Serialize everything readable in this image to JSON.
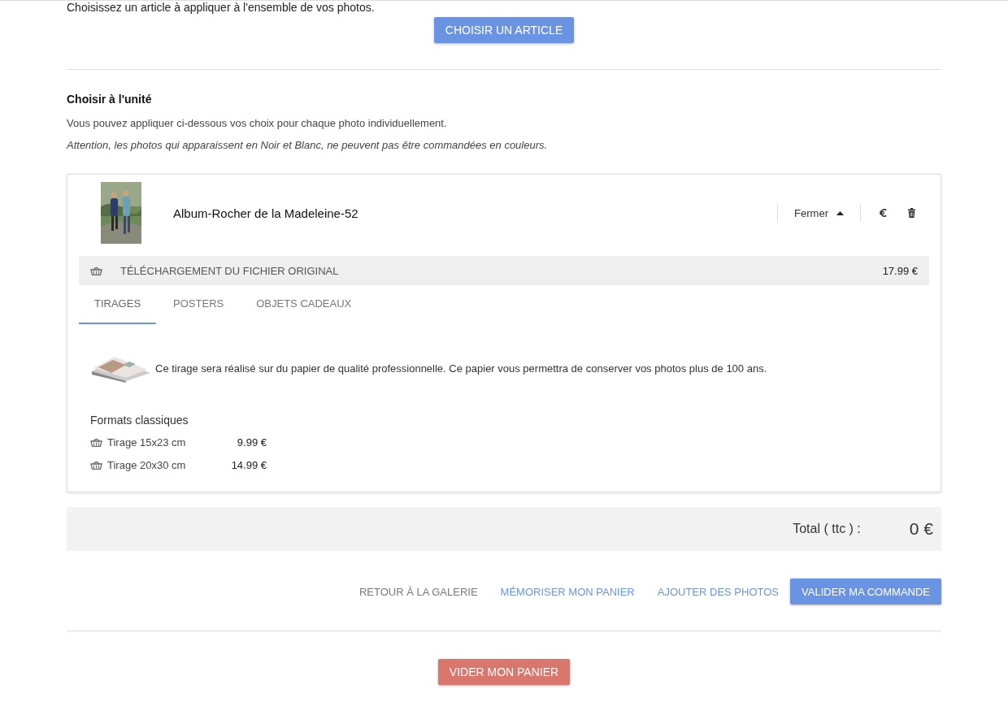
{
  "intro": "Choisissez un article à appliquer à l'ensemble de vos photos.",
  "choose_button": "CHOISIR UN ARTICLE",
  "unit_section": {
    "title": "Choisir à l'unité",
    "description": "Vous pouvez appliquer ci-dessous vos choix pour chaque photo individuellement.",
    "warning": "Attention, les photos qui apparaissent en Noir et Blanc, ne peuvent pas être commandées en couleurs."
  },
  "photo_card": {
    "title": "Album-Rocher de la Madeleine-52",
    "toggle": {
      "label": "Fermer",
      "expanded": true
    },
    "download": {
      "label": "TÉLÉCHARGEMENT DU FICHIER ORIGINAL",
      "price": "17.99 €"
    },
    "tabs": [
      {
        "label": "TIRAGES",
        "selected": true
      },
      {
        "label": "POSTERS",
        "selected": false
      },
      {
        "label": "OBJETS CADEAUX",
        "selected": false
      }
    ],
    "description": "Ce tirage sera réalisé sur du papier de qualité professionnelle. Ce papier vous permettra de conserver vos photos plus de 100 ans.",
    "formats_title": "Formats classiques",
    "formats": [
      {
        "name": "Tirage 15x23 cm",
        "price": "9.99 €"
      },
      {
        "name": "Tirage 20x30 cm",
        "price": "14.99 €"
      }
    ]
  },
  "total": {
    "label": "Total ( ttc ) :",
    "value": "0 €"
  },
  "actions": [
    {
      "label": "RETOUR À LA GALERIE",
      "kind": "plain"
    },
    {
      "label": "MÉMORISER MON PANIER",
      "kind": "link"
    },
    {
      "label": "AJOUTER DES PHOTOS",
      "kind": "link"
    },
    {
      "label": "VALIDER MA COMMANDE",
      "kind": "primary"
    }
  ],
  "empty_button": "VIDER MON PANIER"
}
